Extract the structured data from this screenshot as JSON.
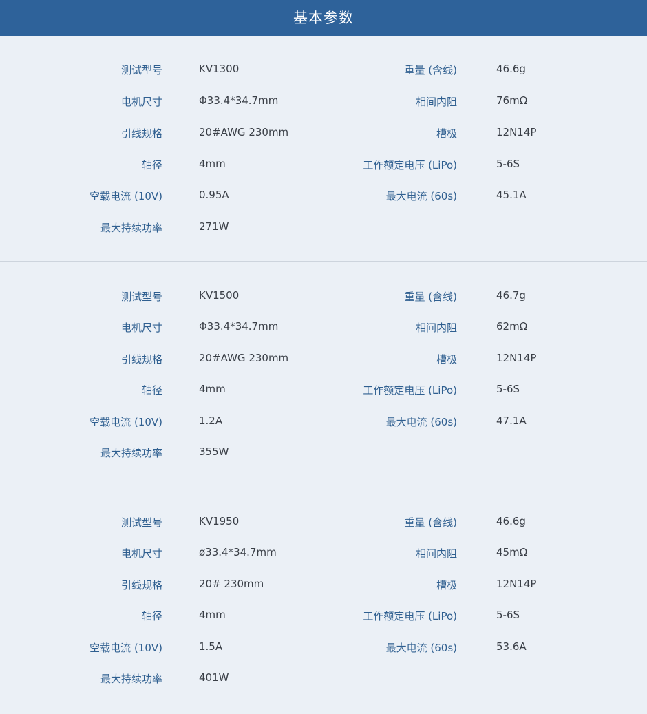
{
  "header": {
    "title": "基本参数"
  },
  "labels": {
    "model": "测试型号",
    "size": "电机尺寸",
    "lead": "引线规格",
    "shaft": "轴径",
    "noload": "空载电流 (10V)",
    "power": "最大持续功率",
    "weight": "重量 (含线)",
    "resistance": "相间内阻",
    "slots": "槽极",
    "voltage": "工作额定电压 (LiPo)",
    "maxcurrent": "最大电流 (60s)"
  },
  "sections": [
    {
      "model": "KV1300",
      "size": "Φ33.4*34.7mm",
      "lead": "20#AWG 230mm",
      "shaft": "4mm",
      "noload": "0.95A",
      "power": "271W",
      "weight": "46.6g",
      "resistance": "76mΩ",
      "slots": "12N14P",
      "voltage": "5-6S",
      "maxcurrent": "45.1A"
    },
    {
      "model": "KV1500",
      "size": "Φ33.4*34.7mm",
      "lead": "20#AWG 230mm",
      "shaft": "4mm",
      "noload": "1.2A",
      "power": "355W",
      "weight": "46.7g",
      "resistance": "62mΩ",
      "slots": "12N14P",
      "voltage": "5-6S",
      "maxcurrent": "47.1A"
    },
    {
      "model": "KV1950",
      "size": "ø33.4*34.7mm",
      "lead": "20# 230mm",
      "shaft": "4mm",
      "noload": "1.5A",
      "power": "401W",
      "weight": "46.6g",
      "resistance": "45mΩ",
      "slots": "12N14P",
      "voltage": "5-6S",
      "maxcurrent": "53.6A"
    }
  ]
}
